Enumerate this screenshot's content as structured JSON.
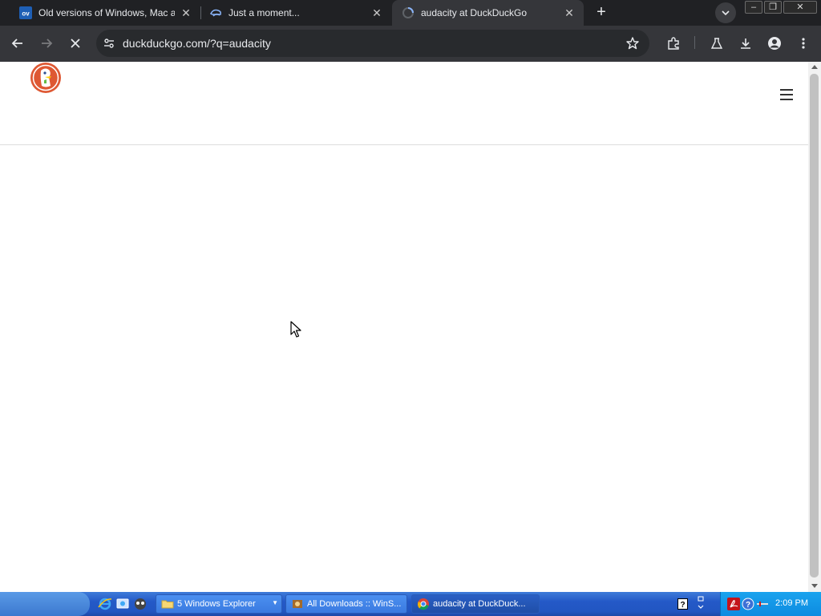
{
  "browser": {
    "tabs": [
      {
        "title": "Old versions of Windows, Mac and",
        "favicon": "ov-favicon",
        "active": false
      },
      {
        "title": "Just a moment...",
        "favicon": "cloudflare-favicon",
        "active": false
      },
      {
        "title": "audacity at DuckDuckGo",
        "favicon": "loading-spinner",
        "active": true
      }
    ],
    "new_tab_label": "+",
    "url": "duckduckgo.com/?q=audacity",
    "window_controls": {
      "minimize": "–",
      "restore": "❐",
      "close": "✕"
    }
  },
  "page": {
    "logo": "duckduckgo-logo",
    "menu_icon": "hamburger-icon"
  },
  "taskbar": {
    "tasks": [
      {
        "label": "5 Windows Explorer",
        "icon": "folder-icon"
      },
      {
        "label": "All Downloads :: WinS...",
        "icon": "winsite-icon"
      },
      {
        "label": "audacity at DuckDuck...",
        "icon": "chrome-icon"
      }
    ],
    "clock": "2:09 PM"
  },
  "colors": {
    "tabbar_bg": "#202124",
    "toolbar_bg": "#35363a",
    "omnibox_bg": "#282a2d",
    "taskbar_blue": "#2459c7",
    "ddg_orange": "#de5833"
  }
}
